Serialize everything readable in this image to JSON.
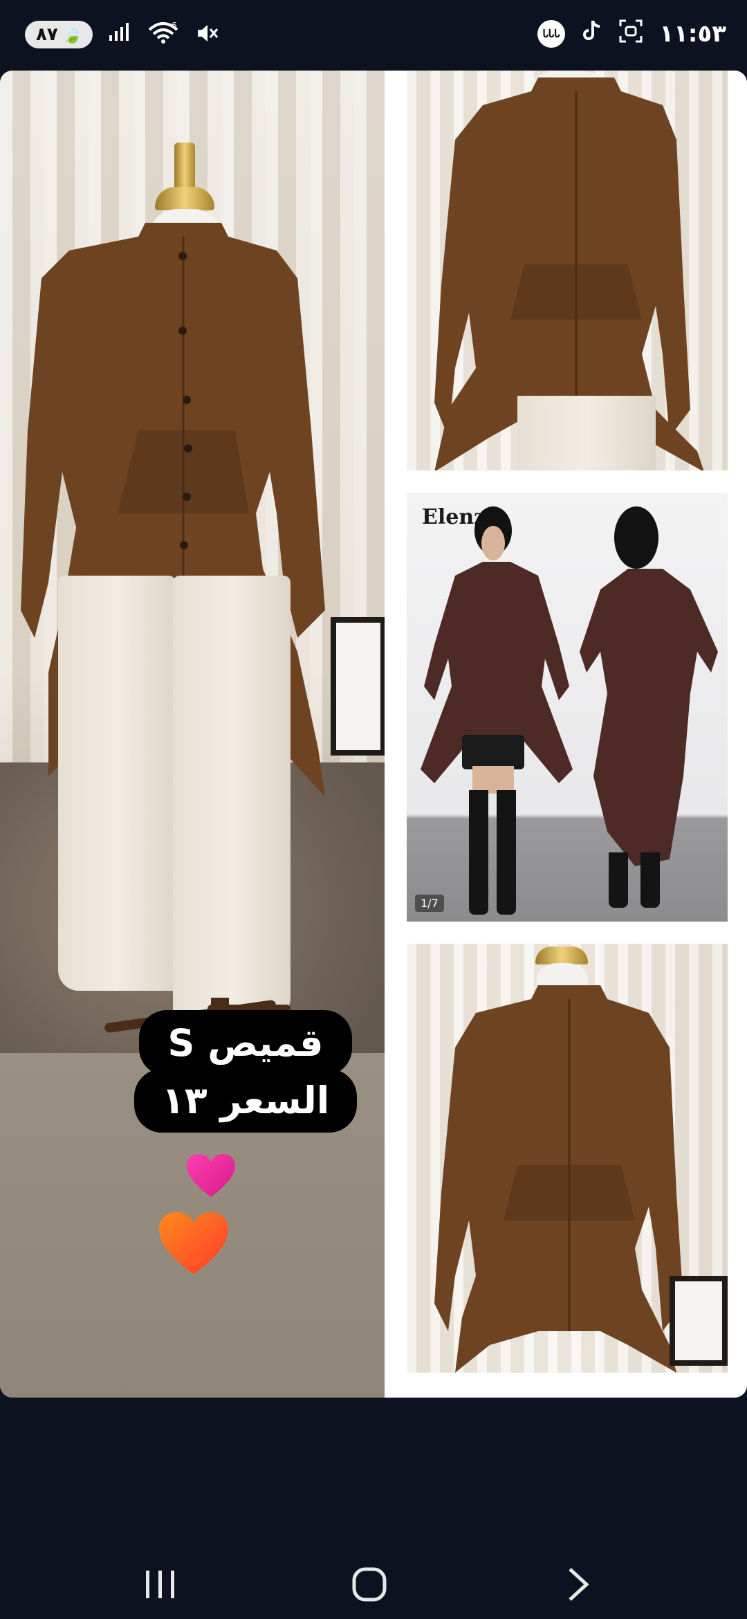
{
  "status_bar": {
    "battery": "٨٧",
    "signal": "!ıll",
    "wifi_badge": "6",
    "clock": "١١:٥٣",
    "app_badge": "ᏓᏓᏓ",
    "icons": [
      "battery-saver-icon",
      "signal-icon",
      "wifi-icon",
      "mute-icon",
      "circle-app-icon",
      "tiktok-icon",
      "screenshot-icon"
    ]
  },
  "story": {
    "sticker": {
      "line1": "قميص S",
      "line2": "السعر ١٣"
    },
    "side_tile_brand": "Elenz",
    "side_tile_counter": "1/7",
    "hearts": [
      {
        "name": "pink-heart",
        "colors": [
          "#ff3fb0",
          "#d71a89"
        ]
      },
      {
        "name": "orange-heart",
        "colors": [
          "#ff8a1a",
          "#ff3a2e"
        ]
      }
    ]
  },
  "navbar": {
    "icons": [
      "recent-apps-icon",
      "home-icon",
      "back-icon"
    ]
  },
  "colors": {
    "shirt": "#6e4322",
    "background": "#0d1220"
  }
}
